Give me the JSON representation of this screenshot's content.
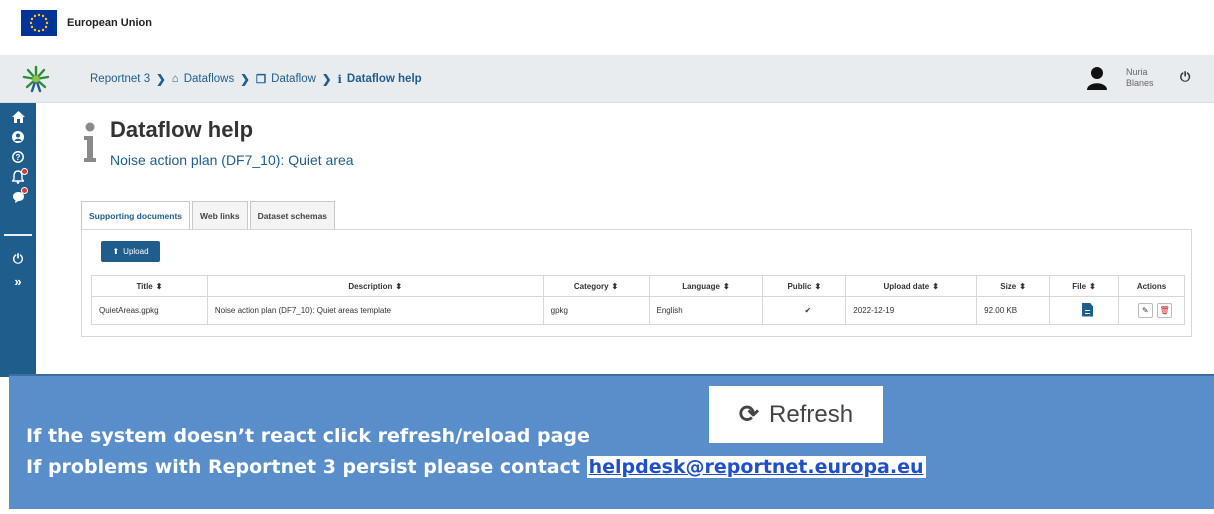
{
  "eu": {
    "title": "European Union"
  },
  "breadcrumb": {
    "items": [
      "Reportnet 3",
      "Dataflows",
      "Dataflow",
      "Dataflow help"
    ]
  },
  "user": {
    "first_name": "Nuria",
    "last_name": "Blanes"
  },
  "page": {
    "title": "Dataflow help",
    "subtitle": "Noise action plan (DF7_10): Quiet area"
  },
  "tabs": [
    "Supporting documents",
    "Web links",
    "Dataset schemas"
  ],
  "upload_label": "Upload",
  "table": {
    "columns": [
      "Title",
      "Description",
      "Category",
      "Language",
      "Public",
      "Upload date",
      "Size",
      "File",
      "Actions"
    ],
    "rows": [
      {
        "title": "QuietAreas.gpkg",
        "description": "Noise action plan (DF7_10): Quiet areas template",
        "category": "gpkg",
        "language": "English",
        "public": "✔",
        "upload_date": "2022-12-19",
        "size": "92.00 KB"
      }
    ]
  },
  "notice": {
    "line1": "If the system doesn’t react click refresh/reload page",
    "line2_prefix": "If problems with Reportnet 3 persist please contact ",
    "email": "helpdesk@reportnet.europa.eu",
    "refresh_label": "Refresh"
  },
  "colors": {
    "primary": "#1e5d8c",
    "notice_bg": "#5a8ecb",
    "eu_blue": "#003399",
    "eu_gold": "#ffcc00"
  }
}
